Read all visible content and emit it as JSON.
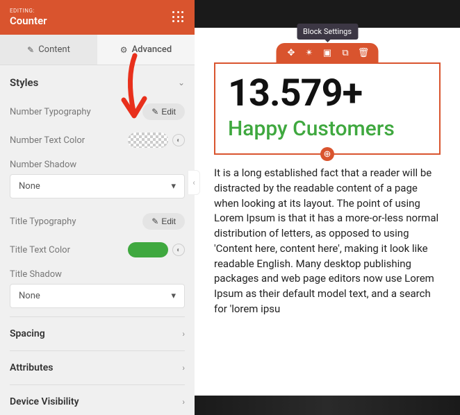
{
  "header": {
    "label": "EDITING:",
    "title": "Counter"
  },
  "tabs": {
    "content": "Content",
    "advanced": "Advanced"
  },
  "styles": {
    "heading": "Styles",
    "numberTypography": "Number Typography",
    "numberTextColor": "Number Text Color",
    "numberShadow": "Number Shadow",
    "titleTypography": "Title Typography",
    "titleTextColor": "Title Text Color",
    "titleShadow": "Title Shadow",
    "editBtn": "Edit",
    "shadowNone": "None"
  },
  "sections": {
    "spacing": "Spacing",
    "attributes": "Attributes",
    "deviceVisibility": "Device Visibility"
  },
  "preview": {
    "tooltip": "Block Settings",
    "counterNumber": "13.579+",
    "counterTitle": "Happy Customers",
    "bodyText": "It is a long established fact that a reader will be distracted by the readable content of a page when looking at its layout. The point of using Lorem Ipsum is that it has a more-or-less normal distribution of letters, as opposed to using 'Content here, content here', making it look like readable English. Many desktop publishing packages and web page editors now use Lorem Ipsum as their default model text, and a search for 'lorem ipsu"
  },
  "colors": {
    "accent": "#d9542e",
    "titleColor": "#3fa83f"
  }
}
